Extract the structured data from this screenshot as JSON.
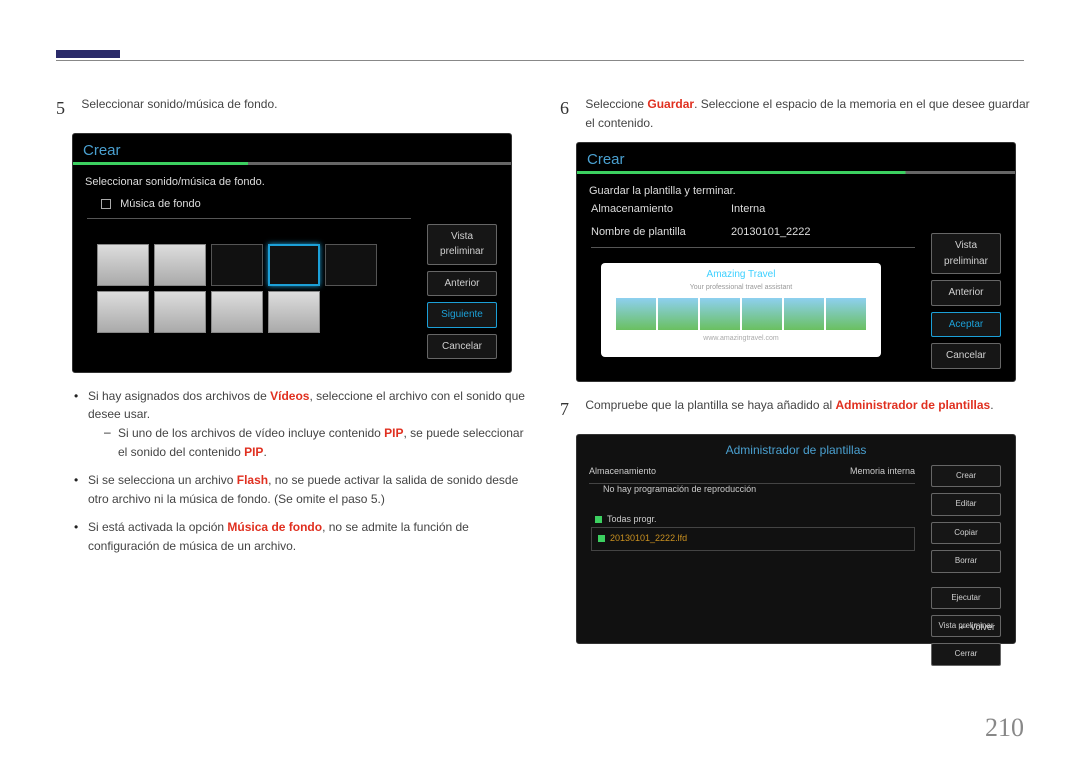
{
  "page_number": "210",
  "step5": {
    "num": "5",
    "text": "Seleccionar sonido/música de fondo.",
    "screen_title": "Crear",
    "prompt": "Seleccionar sonido/música de fondo.",
    "checkbox_label": "Música de fondo",
    "btn_preview": "Vista preliminar",
    "btn_prev": "Anterior",
    "btn_next": "Siguiente",
    "btn_cancel": "Cancelar"
  },
  "bullets5": {
    "b1_a": "Si hay asignados dos archivos de ",
    "b1_hl": "Vídeos",
    "b1_b": ", seleccione el archivo con el sonido que desee usar.",
    "s1_a": "Si uno de los archivos de vídeo incluye contenido ",
    "s1_hl": "PIP",
    "s1_b": ", se puede seleccionar el sonido del contenido ",
    "s1_hl2": "PIP",
    "s1_c": ".",
    "b2_a": "Si se selecciona un archivo ",
    "b2_hl": "Flash",
    "b2_b": ", no se puede activar la salida de sonido desde otro archivo ni la música de fondo. (Se omite el paso 5.)",
    "b3_a": "Si está activada la opción ",
    "b3_hl": "Música de fondo",
    "b3_b": ", no se admite la función de configuración de música de un archivo."
  },
  "step6": {
    "num": "6",
    "text_a": "Seleccione ",
    "text_hl": "Guardar",
    "text_b": ". Seleccione el espacio de la memoria en el que desee guardar el contenido.",
    "screen_title": "Crear",
    "prompt": "Guardar la plantilla y terminar.",
    "f1_label": "Almacenamiento",
    "f1_value": "Interna",
    "f2_label": "Nombre de plantilla",
    "f2_value": "20130101_2222",
    "btn_preview": "Vista preliminar",
    "btn_prev": "Anterior",
    "btn_accept": "Aceptar",
    "btn_cancel": "Cancelar",
    "preview_title": "Amazing Travel",
    "preview_sub": "Your professional travel assistant",
    "preview_url": "www.amazingtravel.com"
  },
  "step7": {
    "num": "7",
    "text_a": "Compruebe que la plantilla se haya añadido al ",
    "text_hl": "Administrador de plantillas",
    "text_b": ".",
    "title": "Administrador de plantillas",
    "col_a": "Almacenamiento",
    "col_b": "Memoria interna",
    "sub1": "No hay programación de reproducción",
    "sub2": "Todas progr.",
    "file": "20130101_2222.lfd",
    "btn_create": "Crear",
    "btn_edit": "Editar",
    "btn_copy": "Copiar",
    "btn_delete": "Borrar",
    "btn_run": "Ejecutar",
    "btn_preview": "Vista preliminar",
    "btn_close": "Cerrar",
    "back": "Volver"
  }
}
